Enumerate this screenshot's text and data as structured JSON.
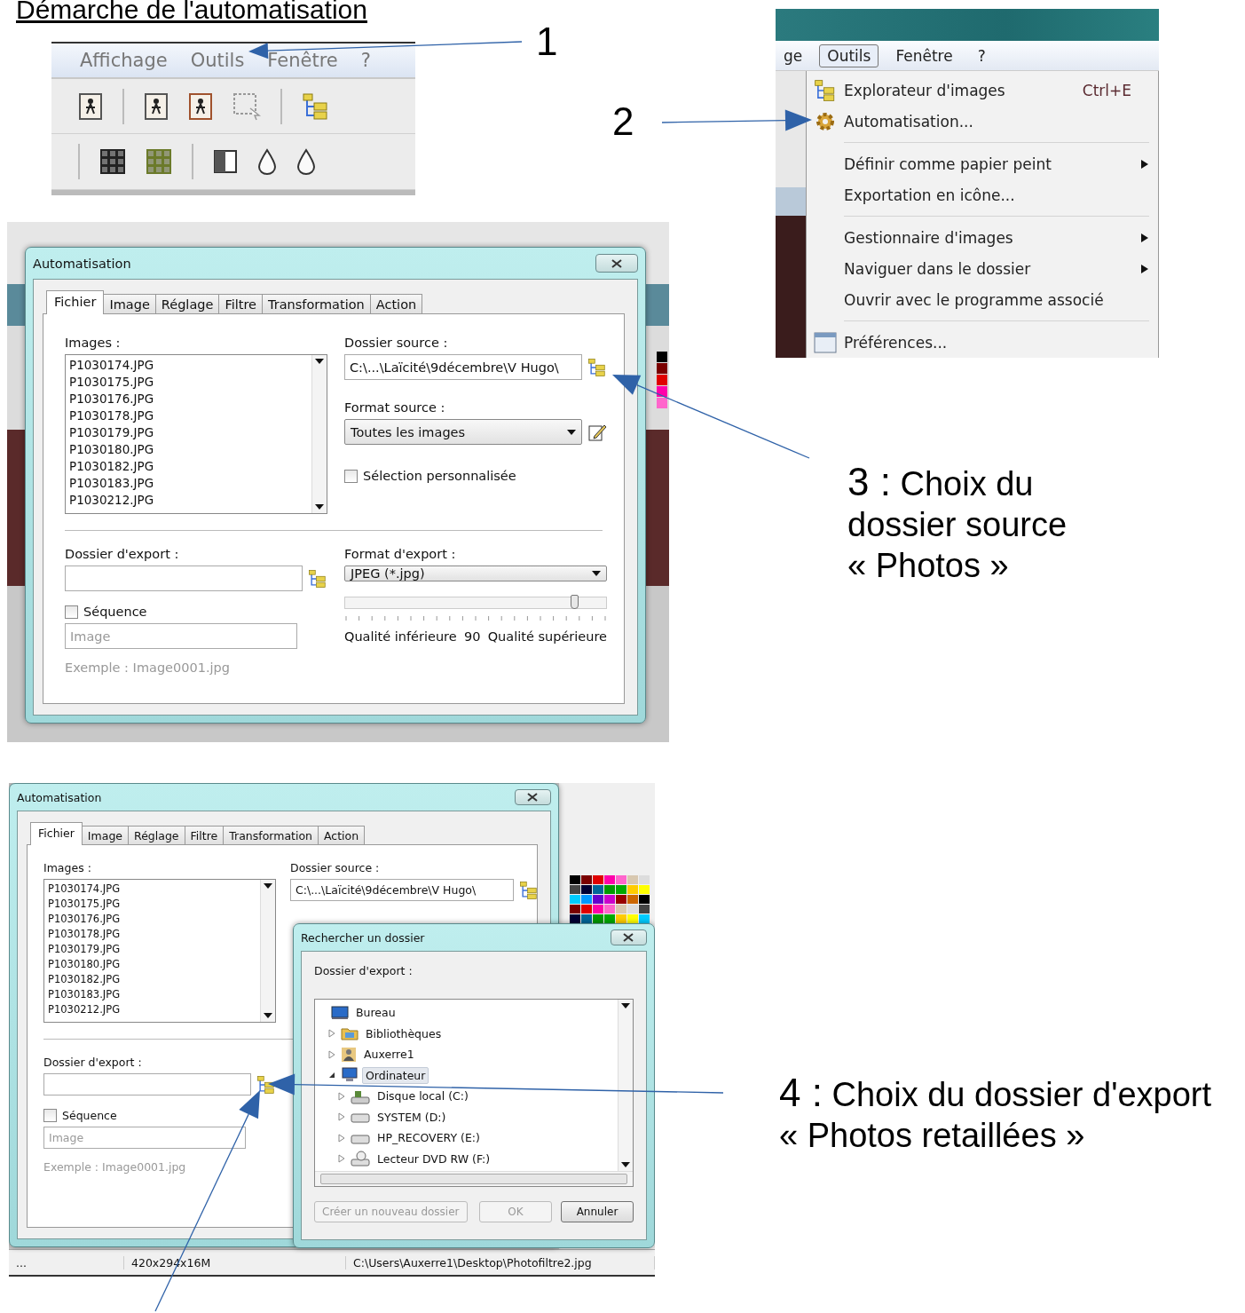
{
  "title": "Démarche de l'automatisation",
  "toolbar_shot": {
    "menu": [
      {
        "label": "Affichage"
      },
      {
        "label": "Outils"
      },
      {
        "label": "Fenêtre"
      },
      {
        "label": "?"
      }
    ]
  },
  "menu_shot": {
    "menubar": [
      {
        "label": "ge",
        "selected": false
      },
      {
        "label": "Outils",
        "selected": true
      },
      {
        "label": "Fenêtre",
        "selected": false
      },
      {
        "label": "?",
        "selected": false
      }
    ],
    "items": [
      {
        "kind": "item",
        "label": "Explorateur d'images",
        "shortcut": "Ctrl+E",
        "submenu": false
      },
      {
        "kind": "item",
        "label": "Automatisation...",
        "submenu": false
      },
      {
        "kind": "separator"
      },
      {
        "kind": "item",
        "label": "Définir comme papier peint",
        "submenu": true
      },
      {
        "kind": "item",
        "label": "Exportation en icône...",
        "submenu": false
      },
      {
        "kind": "separator"
      },
      {
        "kind": "item",
        "label": "Gestionnaire d'images",
        "submenu": true
      },
      {
        "kind": "item",
        "label": "Naviguer dans le dossier",
        "submenu": true
      },
      {
        "kind": "item",
        "label": "Ouvrir avec le programme associé",
        "submenu": false
      },
      {
        "kind": "separator"
      },
      {
        "kind": "item",
        "label": "Préférences...",
        "submenu": false
      }
    ]
  },
  "dialog_shot": {
    "title": "Automatisation",
    "tabs": [
      {
        "label": "Fichier",
        "selected": true
      },
      {
        "label": "Image",
        "selected": false
      },
      {
        "label": "Réglage",
        "selected": false
      },
      {
        "label": "Filtre",
        "selected": false
      },
      {
        "label": "Transformation",
        "selected": false
      },
      {
        "label": "Action",
        "selected": false
      }
    ],
    "images_label": "Images :",
    "images": [
      "P1030174.JPG",
      "P1030175.JPG",
      "P1030176.JPG",
      "P1030178.JPG",
      "P1030179.JPG",
      "P1030180.JPG",
      "P1030182.JPG",
      "P1030183.JPG",
      "P1030212.JPG"
    ],
    "source_label": "Dossier source :",
    "source_value": "C:\\...\\Laïcité\\9décembre\\V Hugo\\",
    "format_source_label": "Format source :",
    "format_source_value": "Toutes les images",
    "custom_selection": {
      "label": "Sélection personnalisée",
      "checked": false
    },
    "export_label": "Dossier d'export :",
    "sequence": {
      "label": "Séquence",
      "checked": false
    },
    "name_field": {
      "value": "Image",
      "disabled": true
    },
    "example": "Exemple : Image0001.jpg",
    "export_format_label": "Format d'export :",
    "export_format_value": "JPEG (*.jpg)",
    "quality": {
      "level": 0.88,
      "low_label": "Qualité inférieure",
      "value": "90",
      "high_label": "Qualité supérieure"
    }
  },
  "browse_shot": {
    "dialog": {
      "title": "Automatisation",
      "tabs": [
        {
          "label": "Fichier",
          "selected": true
        },
        {
          "label": "Image",
          "selected": false
        },
        {
          "label": "Réglage",
          "selected": false
        },
        {
          "label": "Filtre",
          "selected": false
        },
        {
          "label": "Transformation",
          "selected": false
        },
        {
          "label": "Action",
          "selected": false
        }
      ],
      "images_label": "Images :",
      "images": [
        "P1030174.JPG",
        "P1030175.JPG",
        "P1030176.JPG",
        "P1030178.JPG",
        "P1030179.JPG",
        "P1030180.JPG",
        "P1030182.JPG",
        "P1030183.JPG",
        "P1030212.JPG"
      ],
      "source_label": "Dossier source :",
      "source_value": "C:\\...\\Laïcité\\9décembre\\V Hugo\\",
      "export_label": "Dossier d'export :",
      "sequence": {
        "label": "Séquence",
        "checked": false
      },
      "name_field": {
        "value": "Image",
        "disabled": true
      },
      "example": "Exemple : Image0001.jpg"
    },
    "folder_dialog": {
      "title": "Rechercher un dossier",
      "prompt": "Dossier d'export :",
      "tree": [
        {
          "label": "Bureau",
          "selected": false,
          "children": [
            {
              "label": "Bibliothèques",
              "expanded": false,
              "selected": false
            },
            {
              "label": "Auxerre1",
              "expanded": false,
              "selected": false
            },
            {
              "label": "Ordinateur",
              "expanded": true,
              "selected": true,
              "children": [
                {
                  "label": "Disque local (C:)",
                  "expanded": false,
                  "selected": false
                },
                {
                  "label": "SYSTEM (D:)",
                  "expanded": false,
                  "selected": false
                },
                {
                  "label": "HP_RECOVERY (E:)",
                  "expanded": false,
                  "selected": false
                },
                {
                  "label": "Lecteur DVD RW (F:)",
                  "expanded": false,
                  "selected": false
                }
              ]
            }
          ]
        }
      ],
      "buttons": [
        {
          "label": "Créer un nouveau dossier",
          "disabled": true
        },
        {
          "label": "OK",
          "disabled": true
        },
        {
          "label": "Annuler",
          "disabled": false
        }
      ]
    },
    "status_bar": [
      "...",
      "420x294x16M",
      "C:\\Users\\Auxerre1\\Desktop\\Photofiltre2.jpg"
    ]
  },
  "callouts": [
    {
      "number": "1"
    },
    {
      "number": "2"
    },
    {
      "number": "3 :",
      "lines": [
        "Choix du",
        "dossier source",
        "« Photos »"
      ]
    },
    {
      "number": "4 :",
      "lines": [
        "Choix du dossier d'export",
        "« Photos retaillées »"
      ]
    }
  ]
}
